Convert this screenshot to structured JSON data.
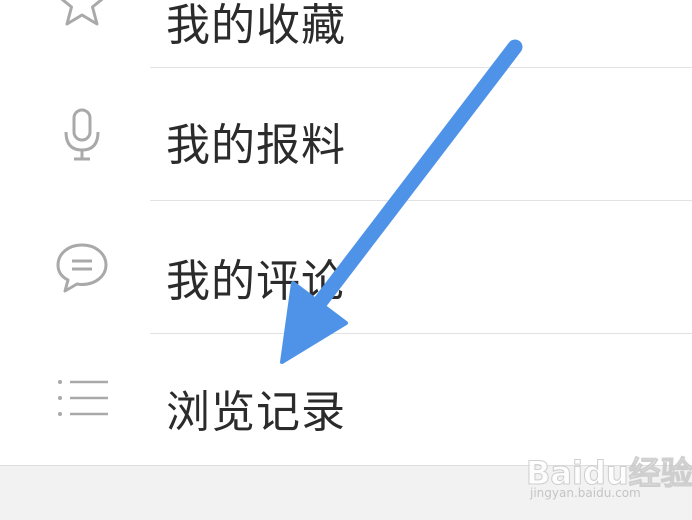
{
  "menu": {
    "items": [
      {
        "label": "我的收藏",
        "icon": "star-icon"
      },
      {
        "label": "我的报料",
        "icon": "microphone-icon"
      },
      {
        "label": "我的评论",
        "icon": "comment-icon"
      },
      {
        "label": "浏览记录",
        "icon": "list-icon"
      }
    ]
  },
  "annotation": {
    "arrow_color": "#4e93e8",
    "arrow_target": "浏览记录"
  },
  "watermark": {
    "logo": "Baidu经验",
    "url": "jingyan.baidu.com"
  },
  "colors": {
    "icon": "#a9a9a9",
    "text": "#2b2b2b",
    "divider": "#e2e2e2"
  }
}
